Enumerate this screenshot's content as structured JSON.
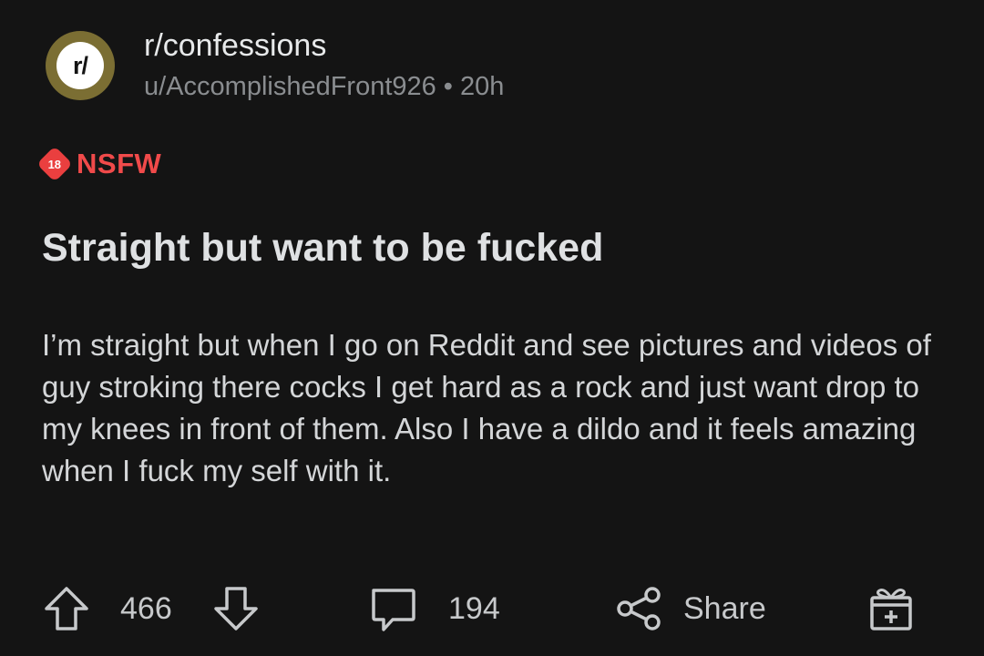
{
  "header": {
    "avatar_text": "r/",
    "subreddit": "r/confessions",
    "user": "u/AccomplishedFront926",
    "separator": "•",
    "time": "20h"
  },
  "nsfw": {
    "badge": "18",
    "label": "NSFW"
  },
  "post": {
    "title": "Straight but want to be fucked",
    "body": "I’m straight but when I go on Reddit and see pictures and videos of guy stroking there cocks I get hard as a rock and just want drop to my knees in front of them. Also I have a dildo and it feels amazing when I fuck my self with it."
  },
  "actions": {
    "upvote_count": "466",
    "comment_count": "194",
    "share_label": "Share"
  },
  "icons": {
    "upvote": "arrow-up-icon",
    "downvote": "arrow-down-icon",
    "comment": "comment-bubble-icon",
    "share": "share-icon",
    "award": "gift-icon"
  },
  "colors": {
    "background": "#141414",
    "nsfw_red": "#ea3f3f",
    "avatar_ring": "#7b6e33",
    "muted_text": "#8a8d90"
  }
}
